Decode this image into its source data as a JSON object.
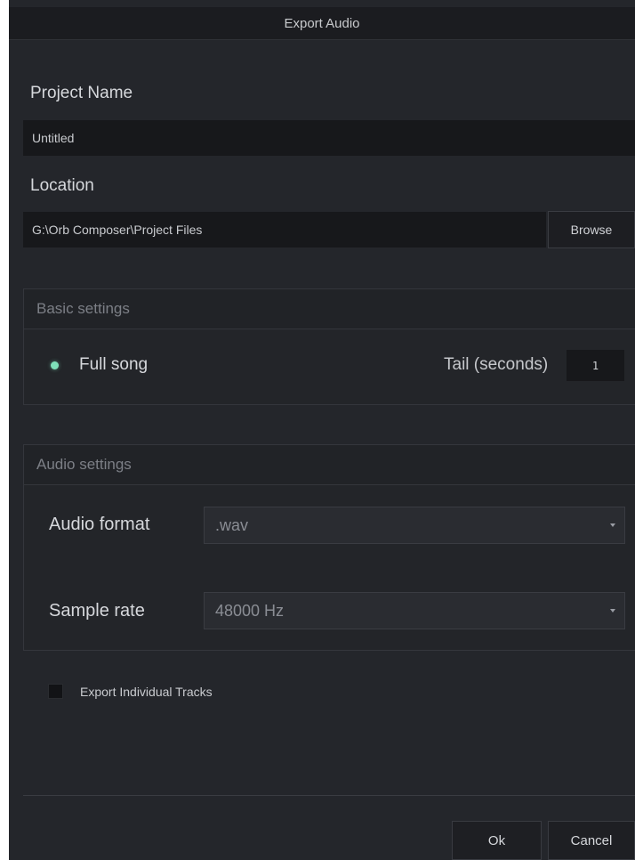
{
  "window": {
    "title": "Export Audio"
  },
  "project": {
    "label": "Project Name",
    "value": "Untitled"
  },
  "location": {
    "label": "Location",
    "value": "G:\\Orb Composer\\Project Files",
    "browse_label": "Browse"
  },
  "basic_settings": {
    "header": "Basic settings",
    "full_song_label": "Full song",
    "full_song_selected": true,
    "tail_label": "Tail (seconds)",
    "tail_value": "1"
  },
  "audio_settings": {
    "header": "Audio settings",
    "format_label": "Audio format",
    "format_value": ".wav",
    "sample_rate_label": "Sample rate",
    "sample_rate_value": "48000 Hz"
  },
  "export_tracks": {
    "label": "Export Individual Tracks",
    "checked": false
  },
  "footer": {
    "ok_label": "Ok",
    "cancel_label": "Cancel"
  },
  "colors": {
    "background": "#24262b",
    "titlebar": "#1b1c20",
    "field": "#17181b",
    "radio_accent": "#7fe0b9"
  },
  "icons": {
    "dropdown": "chevron-down-icon",
    "radio": "radio-selected-icon"
  }
}
